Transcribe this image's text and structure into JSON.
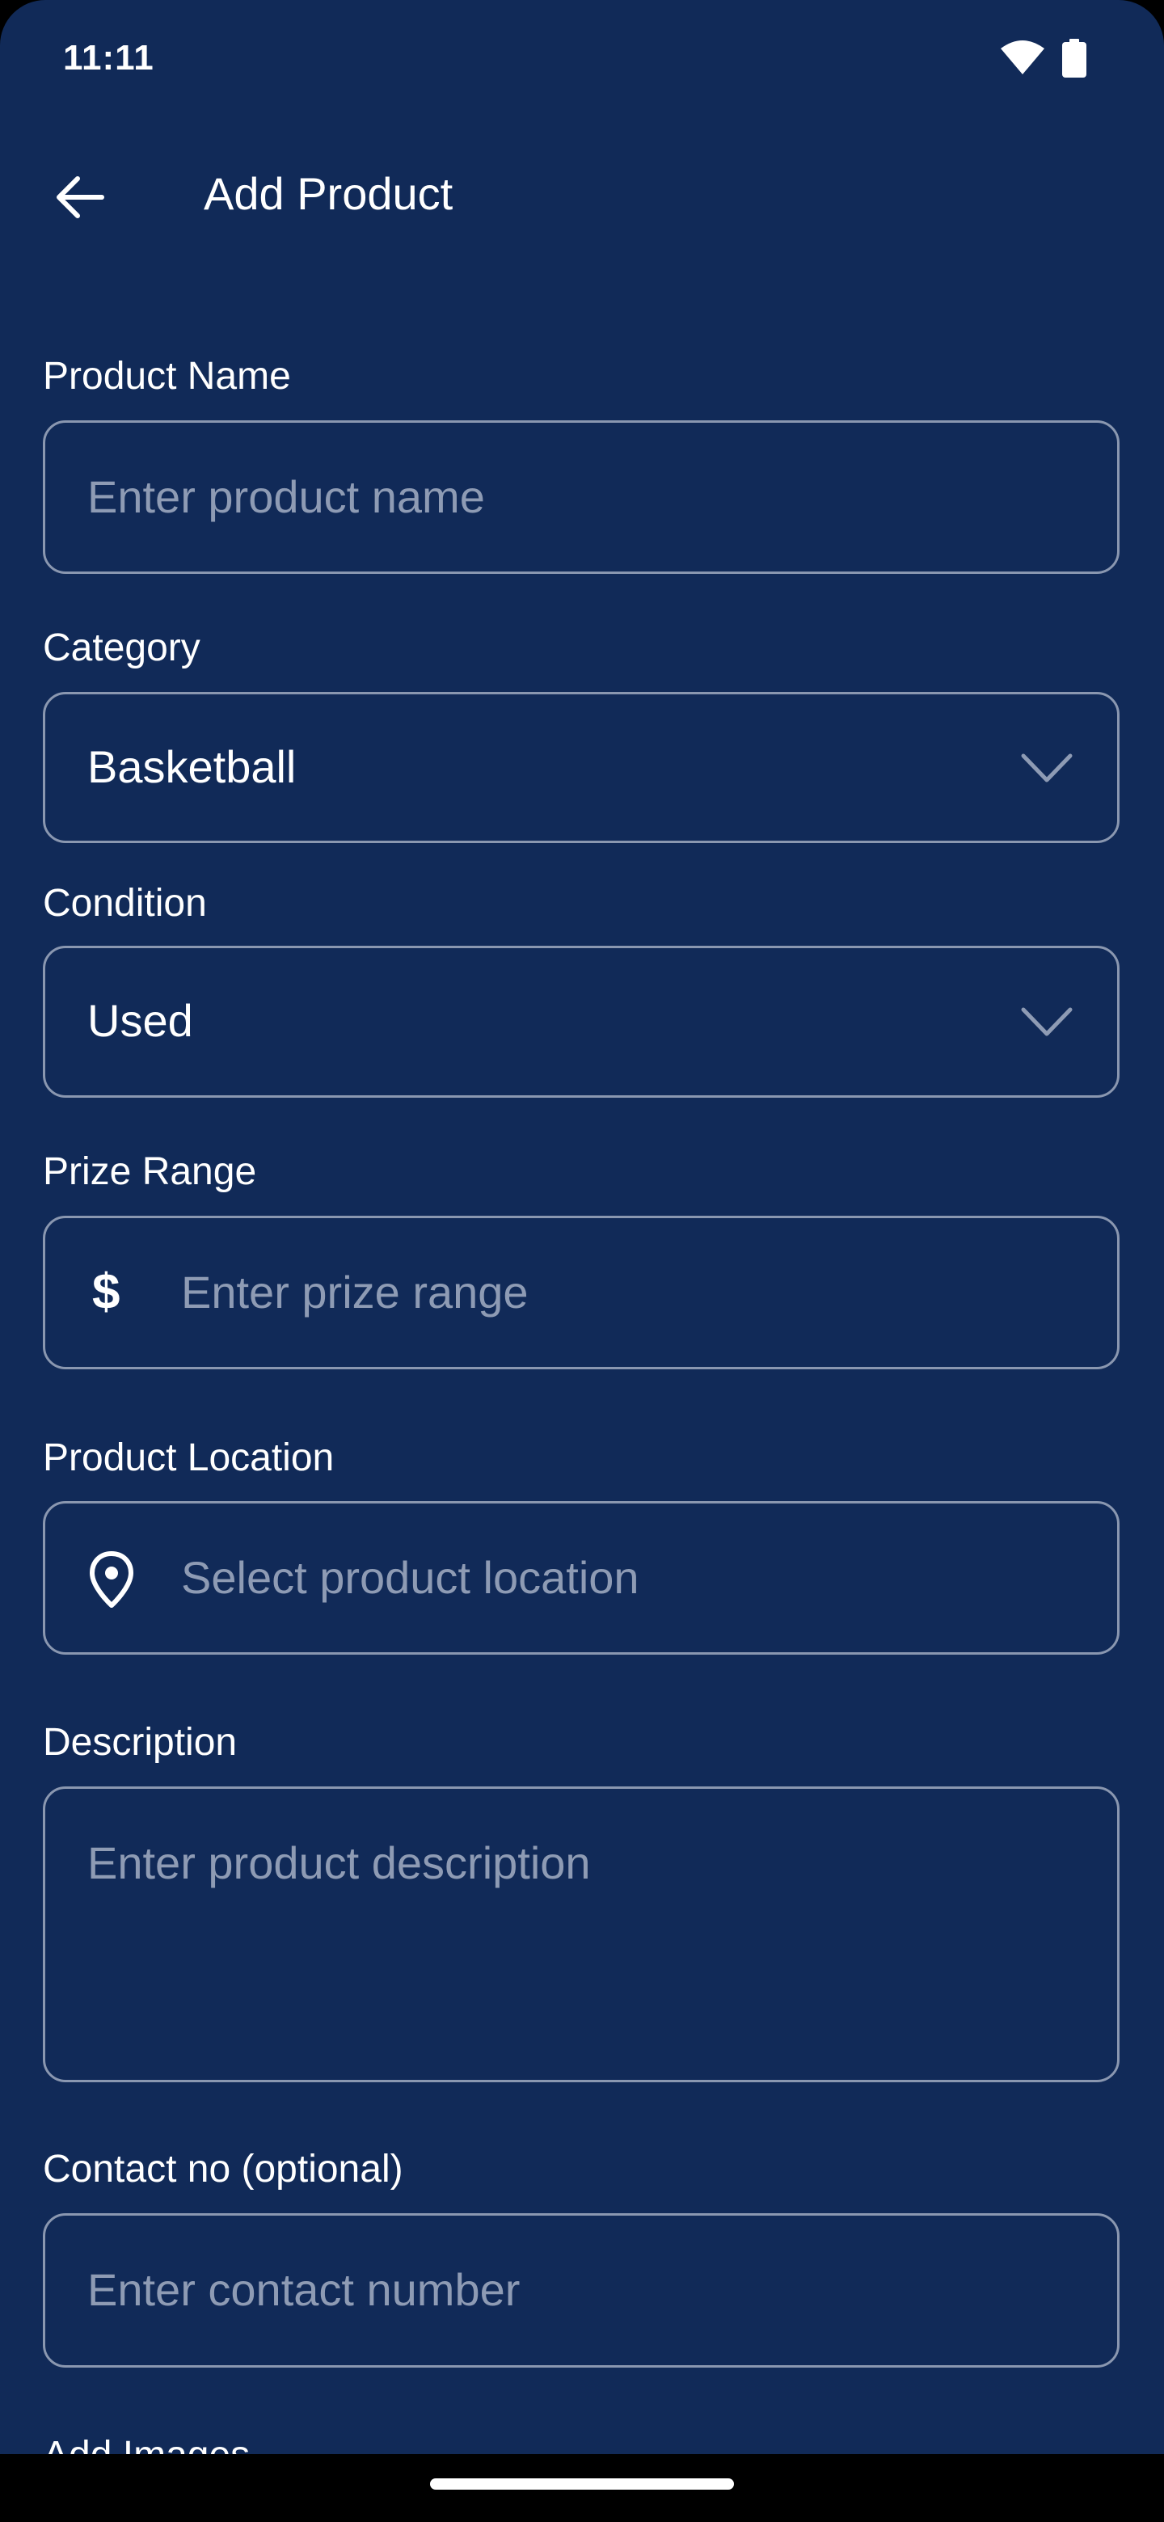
{
  "status_bar": {
    "time": "11:11",
    "icons": [
      "wifi-icon",
      "battery-icon"
    ]
  },
  "app_bar": {
    "back_icon": "arrow-left-icon",
    "title": "Add Product"
  },
  "form": {
    "product_name": {
      "label": "Product Name",
      "placeholder": "Enter product name"
    },
    "category": {
      "label": "Category",
      "selected": "Basketball",
      "icon": "chevron-down-icon"
    },
    "condition": {
      "label": "Condition",
      "selected": "Used",
      "icon": "chevron-down-icon"
    },
    "prize_range": {
      "label": "Prize Range",
      "prefix": "$",
      "placeholder": "Enter prize range"
    },
    "product_location": {
      "label": "Product Location",
      "icon": "location-pin-icon",
      "placeholder": "Select product location"
    },
    "description": {
      "label": "Description",
      "placeholder": "Enter product description"
    },
    "contact_no": {
      "label": "Contact no (optional)",
      "placeholder": "Enter contact number"
    },
    "add_images": {
      "label": "Add Images"
    }
  },
  "colors": {
    "background": "#112a58",
    "border": "#8a97b0",
    "placeholder": "#8e9bb4",
    "text": "#ffffff"
  }
}
